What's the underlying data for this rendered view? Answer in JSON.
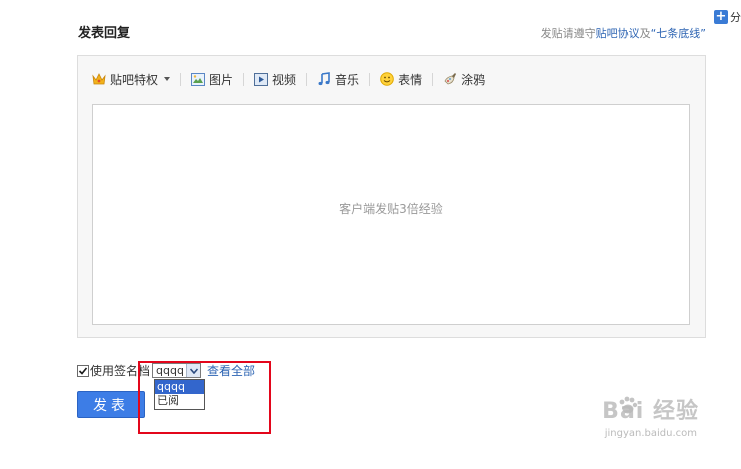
{
  "header": {
    "title": "发表回复",
    "notice_prefix": "发贴请遵守",
    "notice_link1": "贴吧协议",
    "notice_and": "及",
    "notice_link2": "“七条底线”",
    "share_label": "分"
  },
  "toolbar": {
    "privilege": "贴吧特权",
    "image": "图片",
    "video": "视频",
    "music": "音乐",
    "emoji": "表情",
    "graffiti": "涂鸦"
  },
  "editor": {
    "placeholder": "客户端发贴3倍经验"
  },
  "signature": {
    "checkbox_label": "使用签名档",
    "selected": "qqqq",
    "options": [
      "qqqq",
      "已阅"
    ],
    "view_all": "查看全部"
  },
  "submit_label": "发表",
  "watermark": {
    "text": "Bai 经验",
    "url": "jingyan.baidu.com"
  },
  "colors": {
    "accent": "#3d7de6",
    "link": "#2d64b3",
    "highlight_box": "#e3061b"
  }
}
